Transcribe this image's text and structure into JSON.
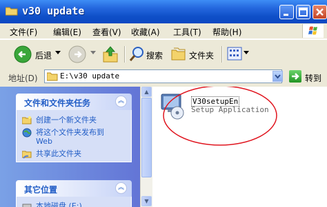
{
  "window": {
    "title": "v30 update"
  },
  "menu": [
    "文件(F)",
    "编辑(E)",
    "查看(V)",
    "收藏(A)",
    "工具(T)",
    "帮助(H)"
  ],
  "toolbar": {
    "back": "后退",
    "search": "搜索",
    "folders": "文件夹"
  },
  "address": {
    "label": "地址(D)",
    "value": "E:\\v30 update",
    "go": "转到"
  },
  "left_pane": {
    "tasks_group": {
      "title": "文件和文件夹任务",
      "items": [
        {
          "label": "创建一个新文件夹",
          "icon": "new-folder-icon"
        },
        {
          "label": "将这个文件夹发布到",
          "label2": "Web",
          "icon": "publish-web-icon"
        },
        {
          "label": "共享此文件夹",
          "icon": "share-folder-icon"
        }
      ]
    },
    "other_group": {
      "title": "其它位置",
      "partial_item": "本地磁盘 (E:)"
    }
  },
  "content": {
    "files": [
      {
        "name": "V30setupEn",
        "description": "Setup Application",
        "icon": "setup-application-icon"
      }
    ]
  },
  "colors": {
    "titlebar": "#0b48c2",
    "task_text": "#215dc6",
    "highlight_ellipse": "#e0141e"
  }
}
